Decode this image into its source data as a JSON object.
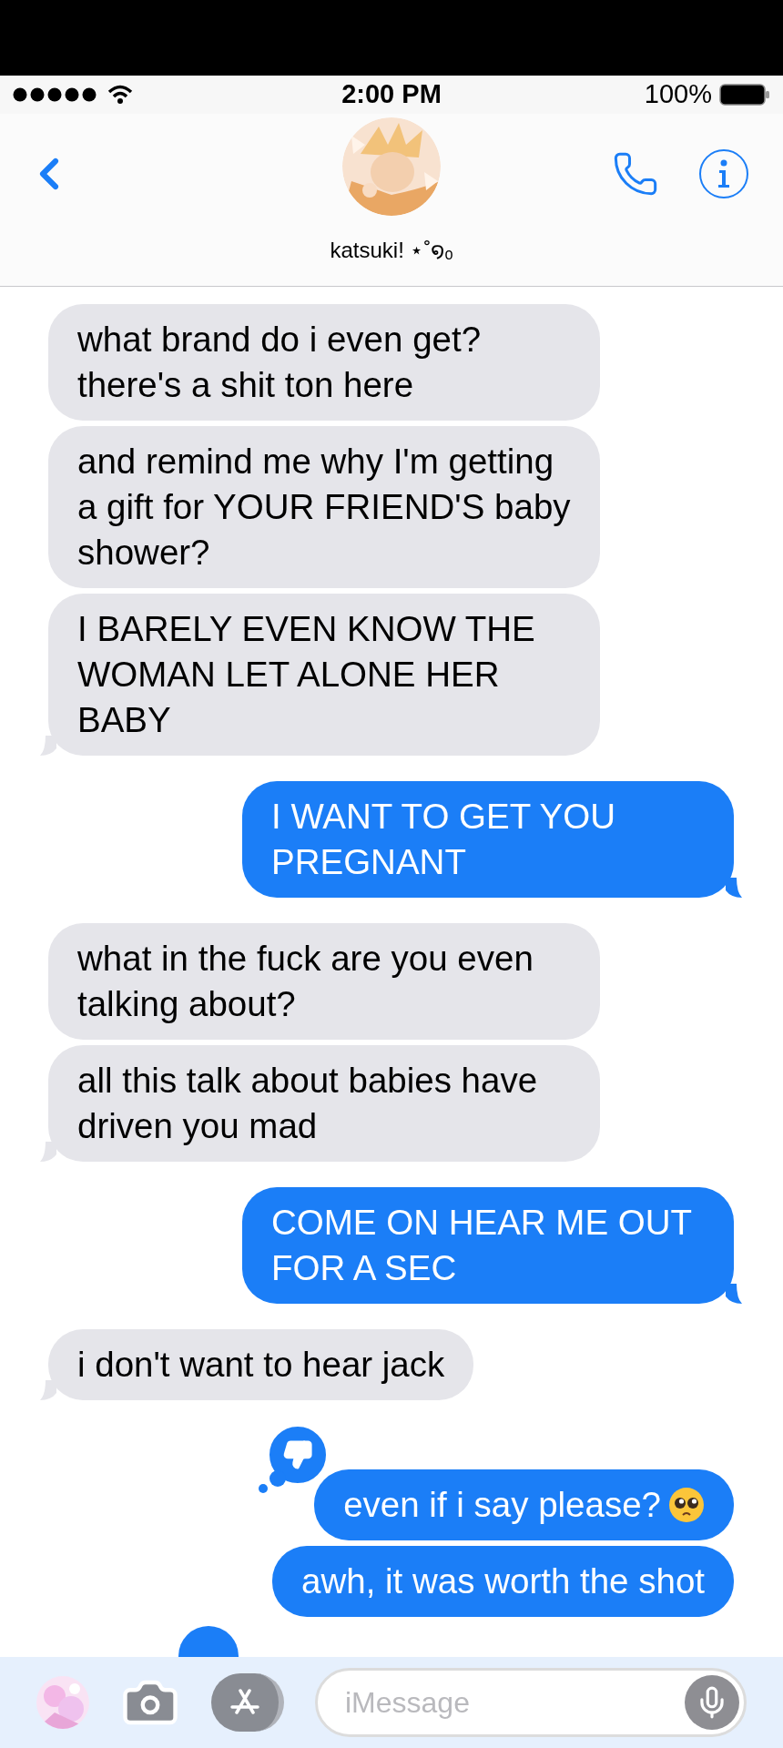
{
  "status_bar": {
    "time": "2:00 PM",
    "battery": "100%"
  },
  "contact": {
    "name": "katsuki! ⋆˚໑ₒ"
  },
  "messages": [
    {
      "kind": "received",
      "text": "what brand do i even get? there's a shit ton here",
      "tail": false
    },
    {
      "kind": "received",
      "text": "and remind me why I'm getting a gift for YOUR FRIEND'S baby shower?",
      "tail": false
    },
    {
      "kind": "received",
      "text": "I BARELY EVEN KNOW THE WOMAN LET ALONE HER BABY",
      "tail": true
    },
    {
      "kind": "sent",
      "text": "I WANT TO GET YOU PREGNANT",
      "tail": true
    },
    {
      "kind": "received",
      "text": "what in the fuck are you even talking about?",
      "tail": false
    },
    {
      "kind": "received",
      "text": "all this talk about babies have driven you mad",
      "tail": true
    },
    {
      "kind": "sent",
      "text": "COME ON HEAR ME OUT FOR A SEC",
      "tail": true
    },
    {
      "kind": "received",
      "text": "i don't want to hear jack",
      "tail": true
    },
    {
      "kind": "sent",
      "text": "even if i say please?",
      "pleading_emoji": true,
      "disliked": true,
      "tail": false
    },
    {
      "kind": "sent",
      "text": "awh, it was worth the shot",
      "tail": false
    }
  ],
  "composer": {
    "placeholder": "iMessage"
  }
}
